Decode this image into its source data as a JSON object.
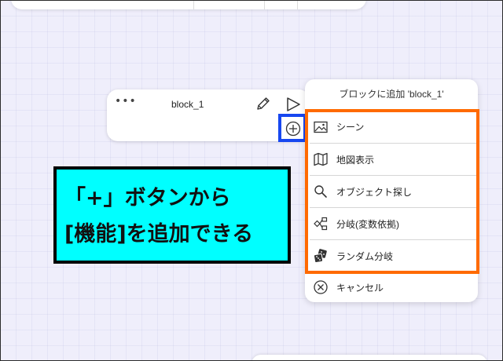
{
  "block": {
    "more_label": "•••",
    "title": "block_1"
  },
  "menu": {
    "header": "ブロックに追加 'block_1'",
    "items": [
      {
        "label": "シーン",
        "icon": "image-icon"
      },
      {
        "label": "地図表示",
        "icon": "map-icon"
      },
      {
        "label": "オブジェクト探し",
        "icon": "search-icon"
      },
      {
        "label": "分岐(変数依拠)",
        "icon": "branch-icon"
      },
      {
        "label": "ランダム分岐",
        "icon": "dice-icon"
      }
    ],
    "cancel_label": "キャンセル"
  },
  "callout": {
    "line1": "「+」ボタンから",
    "line2": "[機能]を追加できる"
  },
  "colors": {
    "accent_blue": "#1747f0",
    "accent_orange": "#ff6a00",
    "callout_bg": "#00ffff",
    "background": "#efeefb"
  }
}
